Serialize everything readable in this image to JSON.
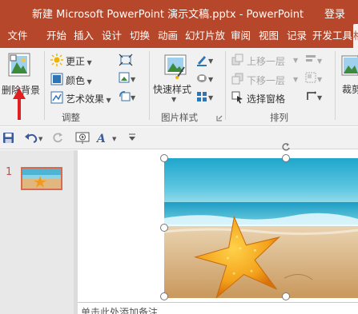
{
  "window": {
    "title": "新建 Microsoft PowerPoint 演示文稿.pptx  -  PowerPoint",
    "login": "登录"
  },
  "tabs": [
    {
      "label": "文件"
    },
    {
      "label": "开始"
    },
    {
      "label": "插入"
    },
    {
      "label": "设计"
    },
    {
      "label": "切换"
    },
    {
      "label": "动画"
    },
    {
      "label": "幻灯片放"
    },
    {
      "label": "审阅"
    },
    {
      "label": "视图"
    },
    {
      "label": "记录"
    },
    {
      "label": "开发工具"
    },
    {
      "label": "格"
    }
  ],
  "ribbon": {
    "remove_bg": "删除背景",
    "adjust": {
      "corrections": "更正",
      "color": "颜色",
      "artistic": "艺术效果",
      "group_label": "调整"
    },
    "picture_styles": {
      "quick_styles": "快速样式",
      "group_label": "图片样式"
    },
    "arrange": {
      "bring_forward": "上移一层",
      "send_backward": "下移一层",
      "selection_pane": "选择窗格",
      "group_label": "排列"
    },
    "crop": "裁剪"
  },
  "slides": {
    "current_number": "1"
  },
  "notes": {
    "placeholder": "单击此处添加备注"
  },
  "colors": {
    "brand": "#b7472a",
    "ribbon_bg": "#f1f1f1",
    "arrow": "#e02020"
  }
}
